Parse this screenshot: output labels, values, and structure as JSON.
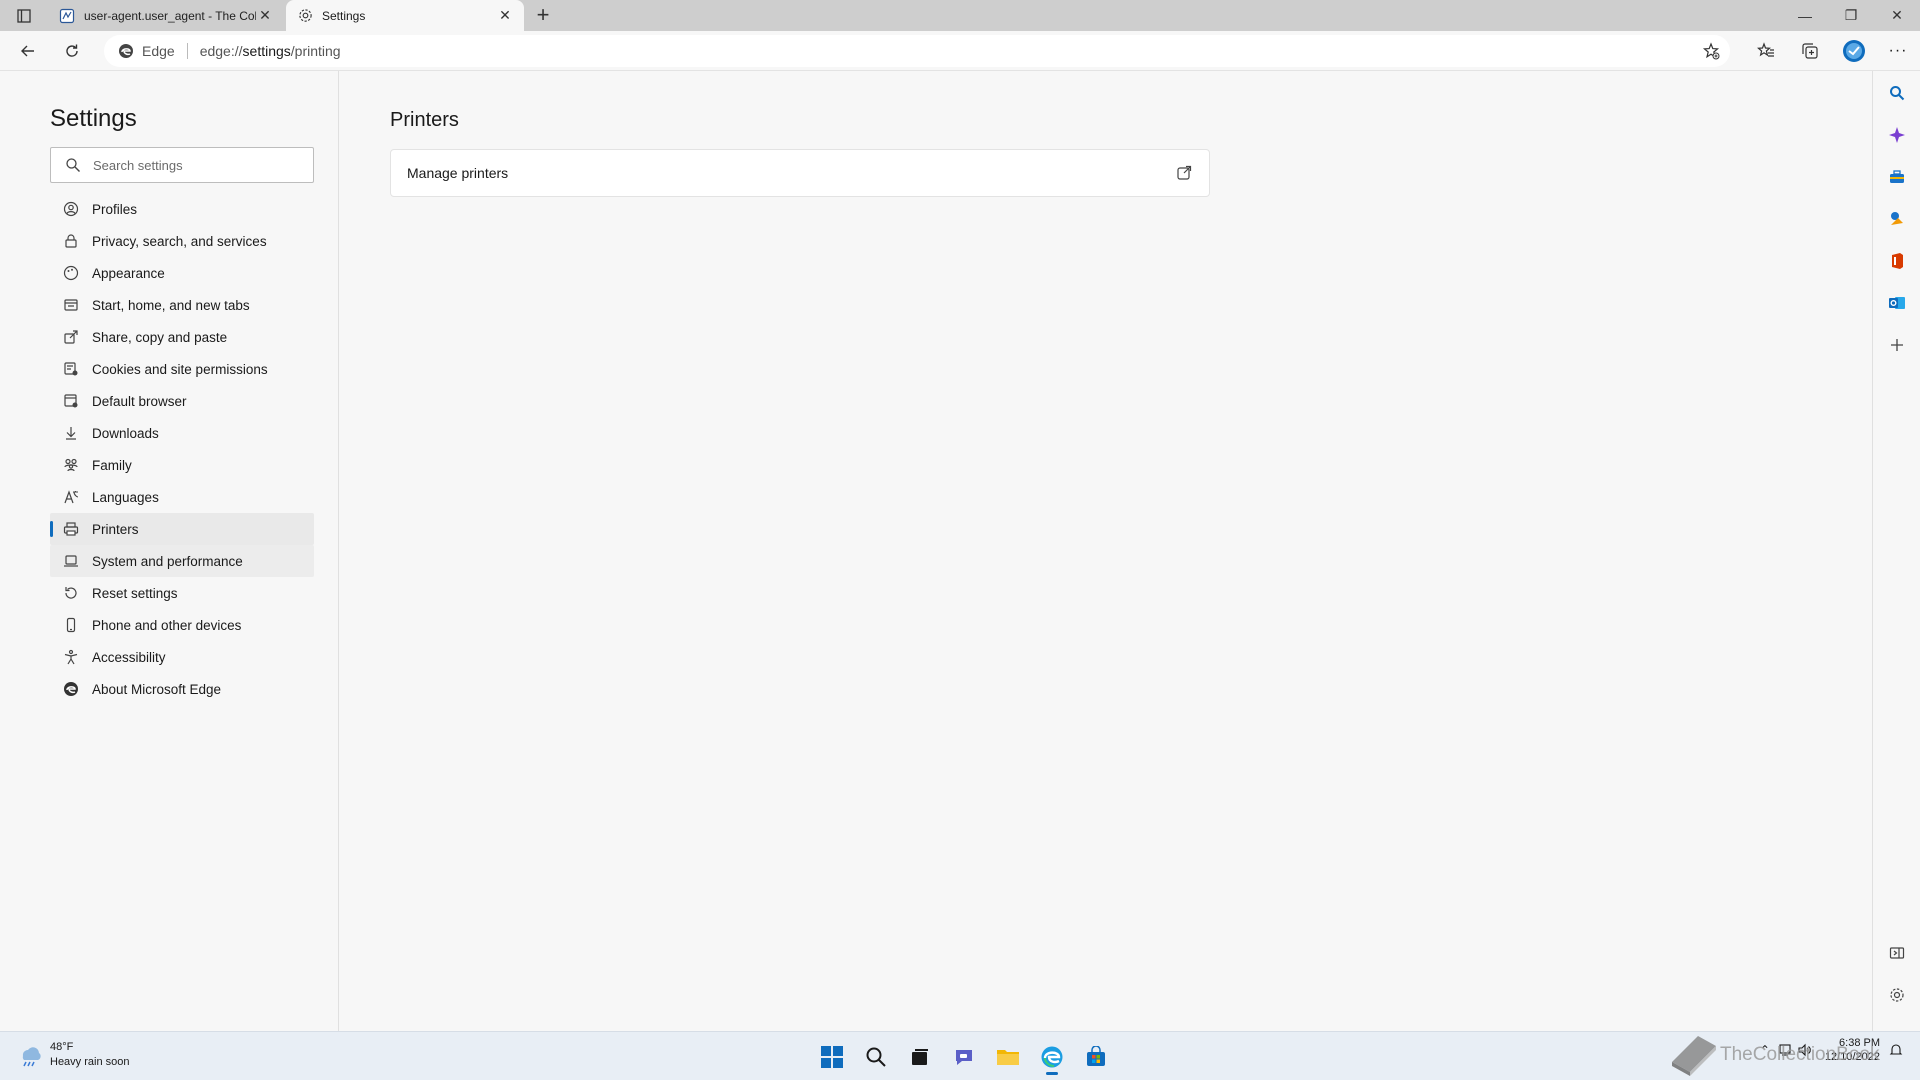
{
  "tabs": [
    {
      "title": "user-agent.user_agent - The Coll",
      "icon": "document-icon"
    },
    {
      "title": "Settings",
      "icon": "gear-icon"
    }
  ],
  "address_bar": {
    "site_label": "Edge",
    "url_prefix": "edge://",
    "url_host": "settings",
    "url_path": "/printing"
  },
  "sidebar": {
    "title": "Settings",
    "search_placeholder": "Search settings",
    "items": [
      {
        "label": "Profiles",
        "icon": "profile-icon"
      },
      {
        "label": "Privacy, search, and services",
        "icon": "lock-icon"
      },
      {
        "label": "Appearance",
        "icon": "appearance-icon"
      },
      {
        "label": "Start, home, and new tabs",
        "icon": "home-tabs-icon"
      },
      {
        "label": "Share, copy and paste",
        "icon": "share-icon"
      },
      {
        "label": "Cookies and site permissions",
        "icon": "cookies-icon"
      },
      {
        "label": "Default browser",
        "icon": "browser-icon"
      },
      {
        "label": "Downloads",
        "icon": "download-icon"
      },
      {
        "label": "Family",
        "icon": "family-icon"
      },
      {
        "label": "Languages",
        "icon": "language-icon"
      },
      {
        "label": "Printers",
        "icon": "printer-icon",
        "active": true
      },
      {
        "label": "System and performance",
        "icon": "laptop-icon"
      },
      {
        "label": "Reset settings",
        "icon": "reset-icon"
      },
      {
        "label": "Phone and other devices",
        "icon": "phone-icon"
      },
      {
        "label": "Accessibility",
        "icon": "accessibility-icon"
      },
      {
        "label": "About Microsoft Edge",
        "icon": "edge-icon"
      }
    ]
  },
  "main": {
    "title": "Printers",
    "card_label": "Manage printers"
  },
  "taskbar": {
    "temperature": "48°F",
    "weather_text": "Heavy rain soon",
    "time": "6:38 PM",
    "date": "12/10/2022"
  },
  "watermark": "TheCollectionBook",
  "colors": {
    "accent": "#0f6cbd",
    "tabstrip": "#cecece",
    "page_bg": "#f7f7f7"
  }
}
